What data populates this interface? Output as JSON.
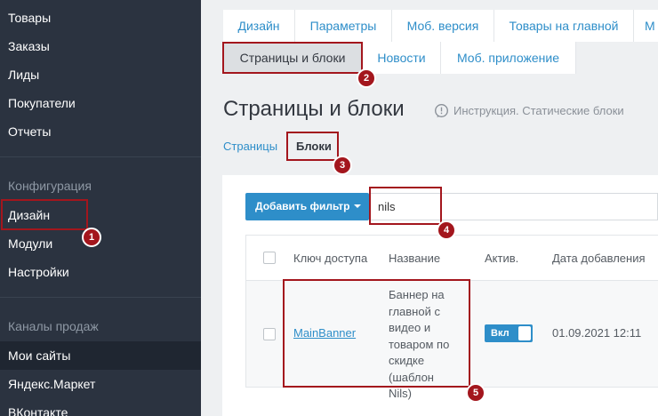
{
  "sidebar": {
    "items_top": [
      {
        "label": "Товары"
      },
      {
        "label": "Заказы"
      },
      {
        "label": "Лиды"
      },
      {
        "label": "Покупатели"
      },
      {
        "label": "Отчеты"
      }
    ],
    "section_config": "Конфигурация",
    "items_config": [
      {
        "label": "Дизайн"
      },
      {
        "label": "Модули"
      },
      {
        "label": "Настройки"
      }
    ],
    "section_channels": "Каналы продаж",
    "items_channels": [
      {
        "label": "Мои сайты"
      },
      {
        "label": "Яндекс.Маркет"
      },
      {
        "label": "ВКонтакте"
      }
    ]
  },
  "tabs": {
    "row1": [
      {
        "label": "Дизайн"
      },
      {
        "label": "Параметры"
      },
      {
        "label": "Моб. версия"
      },
      {
        "label": "Товары на главной"
      },
      {
        "label": "М"
      }
    ],
    "row2": [
      {
        "label": "Страницы и блоки"
      },
      {
        "label": "Новости"
      },
      {
        "label": "Моб. приложение"
      }
    ]
  },
  "page": {
    "title": "Страницы и блоки",
    "help": "Инструкция. Статические блоки",
    "subtabs": [
      {
        "label": "Страницы"
      },
      {
        "label": "Блоки"
      }
    ]
  },
  "toolbar": {
    "add_filter": "Добавить фильтр",
    "search_value": "nils"
  },
  "table": {
    "columns": [
      "Ключ доступа",
      "Название",
      "Актив.",
      "Дата добавления"
    ],
    "rows": [
      {
        "key": "MainBanner",
        "name": "Баннер на главной с видео и товаром по скидке (шаблон Nils)",
        "active_label": "Вкл",
        "date": "01.09.2021 12:11"
      }
    ]
  },
  "markers": [
    "1",
    "2",
    "3",
    "4",
    "5"
  ],
  "colors": {
    "sidebar_bg": "#2b3340",
    "accent": "#2e8ec9",
    "annotation": "#a3161d"
  }
}
